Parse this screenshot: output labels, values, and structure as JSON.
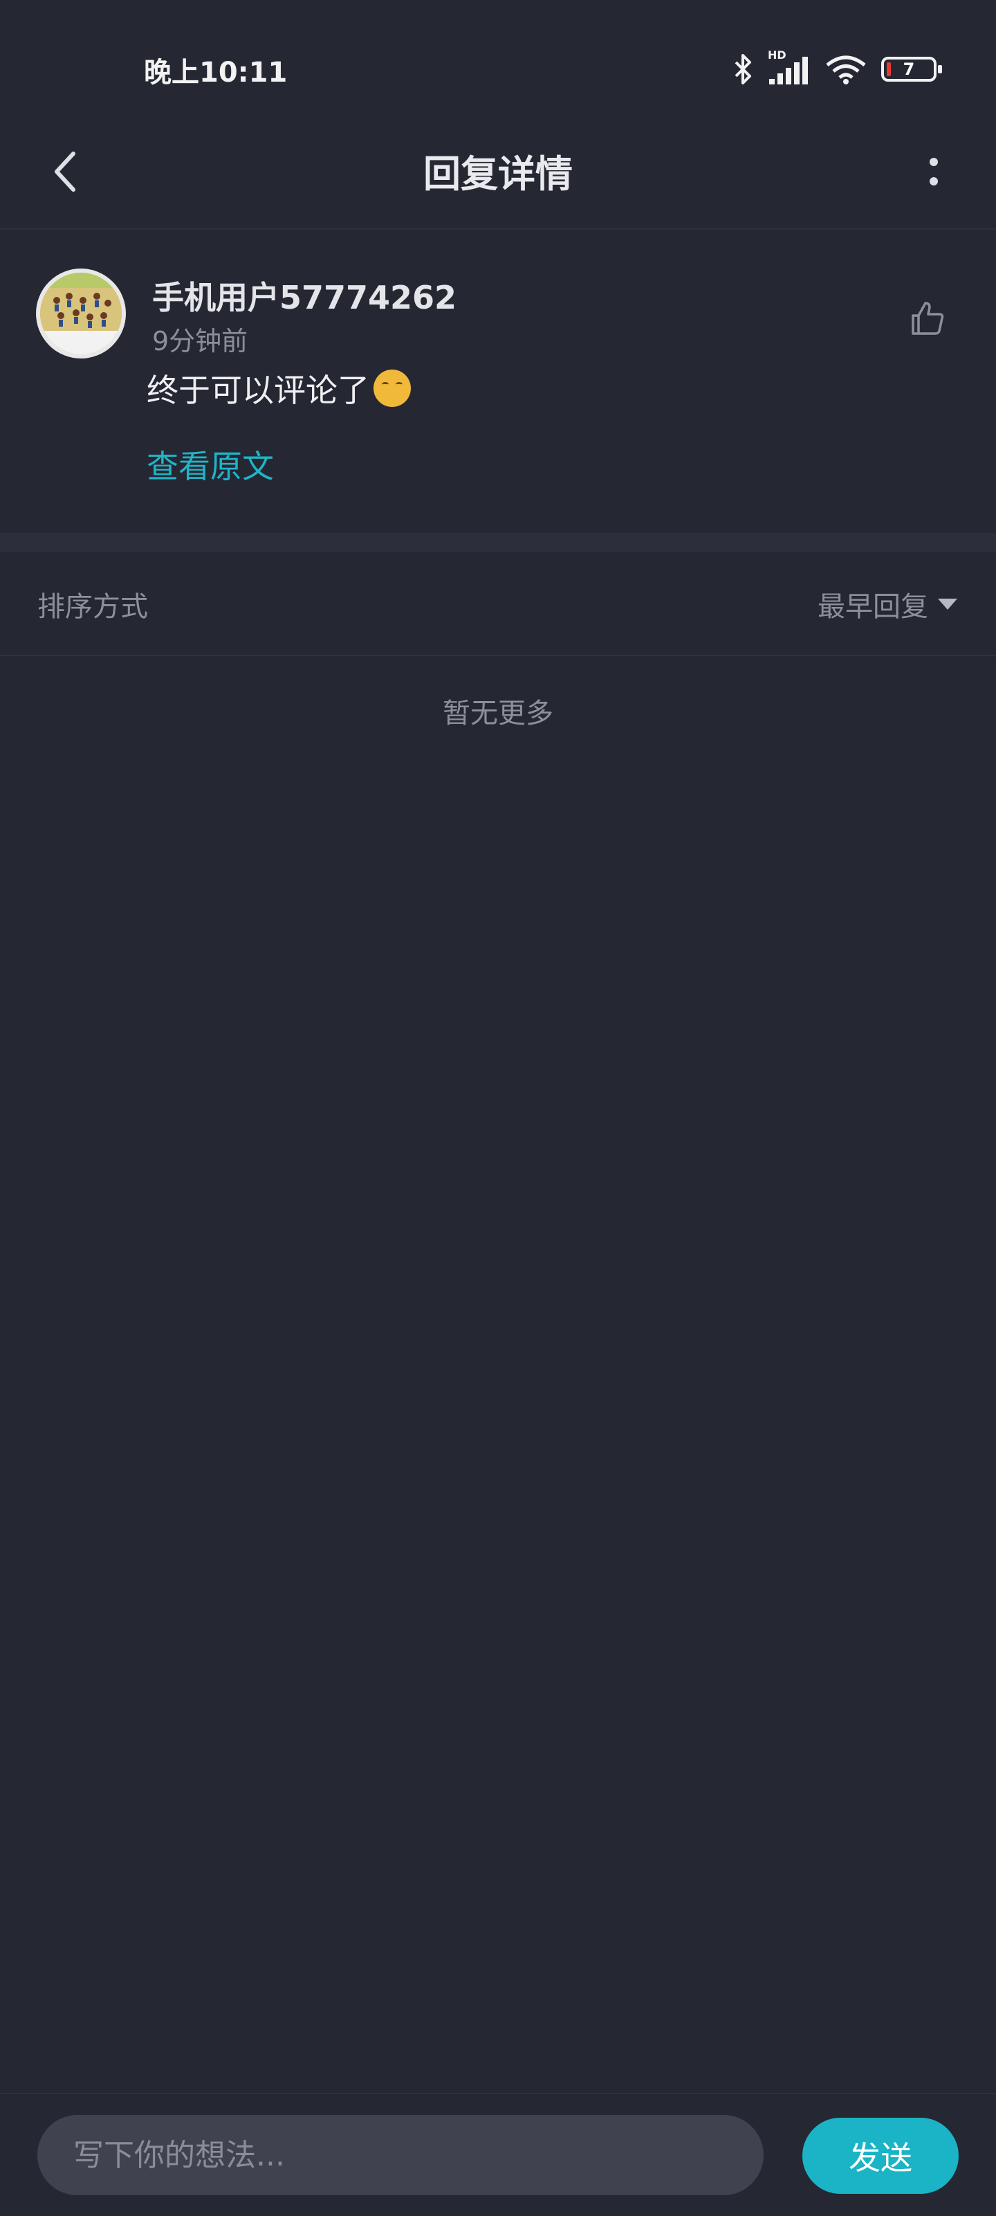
{
  "status_bar": {
    "time": "晚上10:11",
    "network_badge": "HD",
    "battery_level": "7",
    "icons": [
      "bluetooth-icon",
      "signal-icon",
      "wifi-icon",
      "battery-icon"
    ]
  },
  "header": {
    "title": "回复详情",
    "back_icon": "chevron-left-icon",
    "more_icon": "more-vertical-icon"
  },
  "comment": {
    "username": "手机用户57774262",
    "time_ago": "9分钟前",
    "text": "终于可以评论了",
    "emoji": "smiling-face-with-hand-over-mouth",
    "view_original_label": "查看原文",
    "like_icon": "thumbs-up-icon"
  },
  "sort": {
    "label": "排序方式",
    "selected": "最早回复"
  },
  "replies": {
    "empty_text": "暂无更多"
  },
  "composer": {
    "placeholder": "写下你的想法...",
    "send_label": "发送"
  },
  "colors": {
    "background": "#252733",
    "accent": "#1ab4c6",
    "muted_text": "#8d909a"
  }
}
